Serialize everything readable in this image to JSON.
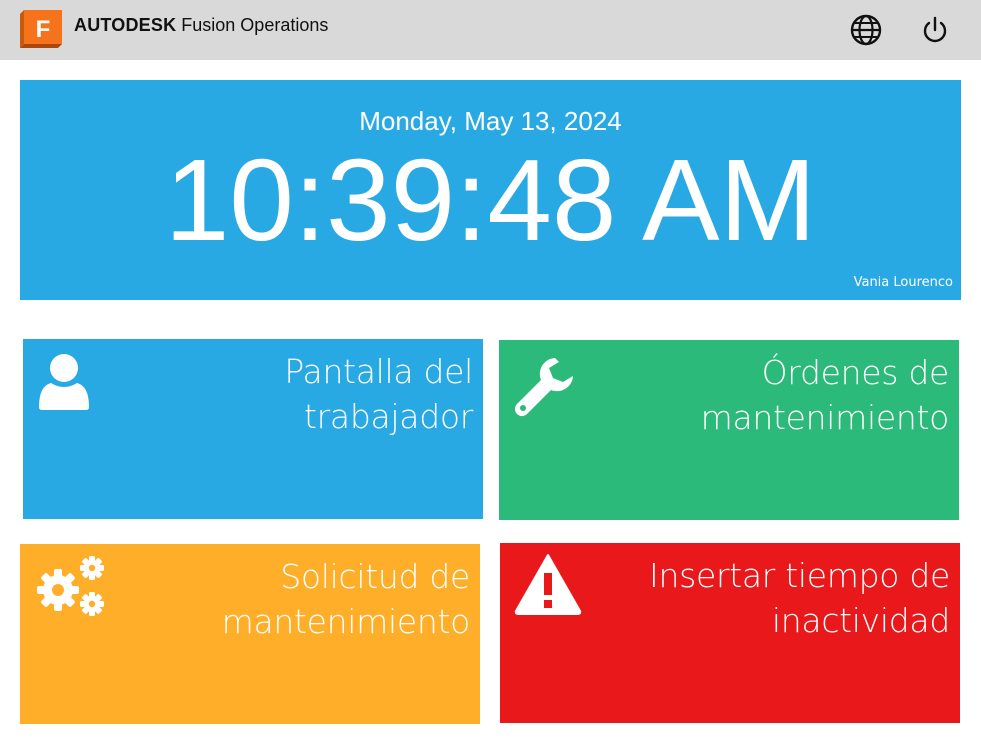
{
  "header": {
    "logo_letter": "F",
    "brand_bold": "AUTODESK",
    "brand_product": "Fusion Operations",
    "language_icon": "globe-icon",
    "logout_icon": "power-icon"
  },
  "clock": {
    "date": "Monday, May 13, 2024",
    "time": "10:39:48 AM",
    "user": "Vania Lourenco"
  },
  "tiles": [
    {
      "label": "Pantalla del\ntrabajador",
      "icon": "user-icon",
      "color": "#29a9e4"
    },
    {
      "label": "Órdenes de\nmantenimiento",
      "icon": "wrench-icon",
      "color": "#2bba79"
    },
    {
      "label": "Solicitud de\nmantenimiento",
      "icon": "gears-icon",
      "color": "#feae29"
    },
    {
      "label": "Insertar tiempo de\ninactividad",
      "icon": "warning-icon",
      "color": "#e8181b"
    }
  ]
}
